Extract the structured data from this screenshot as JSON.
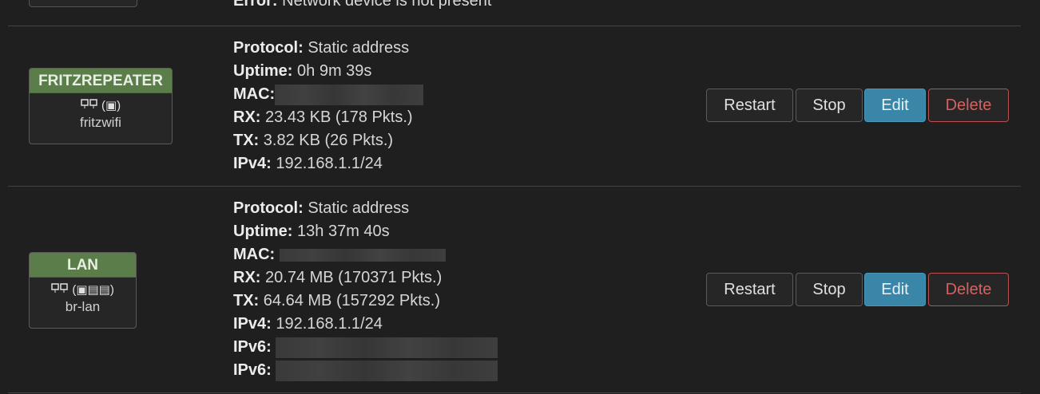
{
  "top": {
    "error_label": "Error:",
    "error_text": "Network device is not present"
  },
  "interfaces": [
    {
      "name": "FRITZREPEATER",
      "icons": "(▣)",
      "device": "fritzwifi",
      "info": {
        "protocol_label": "Protocol:",
        "protocol": "Static address",
        "uptime_label": "Uptime:",
        "uptime": "0h 9m 39s",
        "mac_label": "MAC:",
        "rx_label": "RX:",
        "rx": "23.43 KB (178 Pkts.)",
        "tx_label": "TX:",
        "tx": "3.82 KB (26 Pkts.)",
        "ipv4_label": "IPv4:",
        "ipv4": "192.168.1.1/24"
      },
      "actions": {
        "restart": "Restart",
        "stop": "Stop",
        "edit": "Edit",
        "delete": "Delete"
      }
    },
    {
      "name": "LAN",
      "icons": "(▣▤▤)",
      "device": "br-lan",
      "info": {
        "protocol_label": "Protocol:",
        "protocol": "Static address",
        "uptime_label": "Uptime:",
        "uptime": "13h 37m 40s",
        "mac_label": "MAC:",
        "rx_label": "RX:",
        "rx": "20.74 MB (170371 Pkts.)",
        "tx_label": "TX:",
        "tx": "64.64 MB (157292 Pkts.)",
        "ipv4_label": "IPv4:",
        "ipv4": "192.168.1.1/24",
        "ipv6_label_1": "IPv6:",
        "ipv6_label_2": "IPv6:"
      },
      "actions": {
        "restart": "Restart",
        "stop": "Stop",
        "edit": "Edit",
        "delete": "Delete"
      }
    }
  ],
  "colors": {
    "badge_green": "#5a7d4a",
    "edit_blue": "#3a86a8",
    "delete_red": "#d86060"
  }
}
